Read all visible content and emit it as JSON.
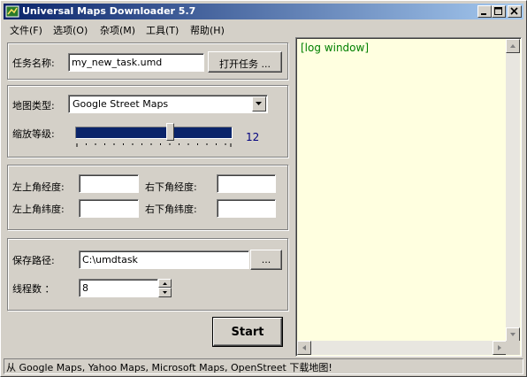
{
  "window": {
    "title": "Universal Maps Downloader 5.7"
  },
  "menu": [
    "文件(F)",
    "选项(O)",
    "杂项(M)",
    "工具(T)",
    "帮助(H)"
  ],
  "task": {
    "name_label": "任务名称:",
    "name_value": "my_new_task.umd",
    "open_button": "打开任务 ..."
  },
  "map": {
    "type_label": "地图类型:",
    "type_value": "Google Street Maps",
    "zoom_label": "缩放等级:",
    "zoom_value": "12",
    "zoom_fraction": 0.61
  },
  "coords": {
    "tl_lon_label": "左上角经度:",
    "br_lon_label": "右下角经度:",
    "tl_lat_label": "左上角纬度:",
    "br_lat_label": "右下角纬度:",
    "tl_lon_value": "",
    "br_lon_value": "",
    "tl_lat_value": "",
    "br_lat_value": ""
  },
  "save": {
    "path_label": "保存路径:",
    "path_value": "C:\\umdtask",
    "browse_button": "...",
    "threads_label": "线程数 ：",
    "threads_value": "8"
  },
  "start_button": "Start",
  "log": {
    "text": "[log window]"
  },
  "status": {
    "text": "从 Google Maps, Yahoo Maps, Microsoft Maps, OpenStreet 下载地图!"
  },
  "colors": {
    "titlebar_start": "#0a246a",
    "titlebar_end": "#a6caf0",
    "log_bg": "#ffffe0",
    "log_text": "#008000",
    "zoom_value": "#00007f"
  },
  "icons": [
    "app-icon",
    "minimize-icon",
    "maximize-icon",
    "close-icon",
    "dropdown-arrow-icon",
    "spin-up-icon",
    "spin-down-icon",
    "scroll-up-icon",
    "scroll-down-icon",
    "scroll-left-icon",
    "scroll-right-icon"
  ]
}
